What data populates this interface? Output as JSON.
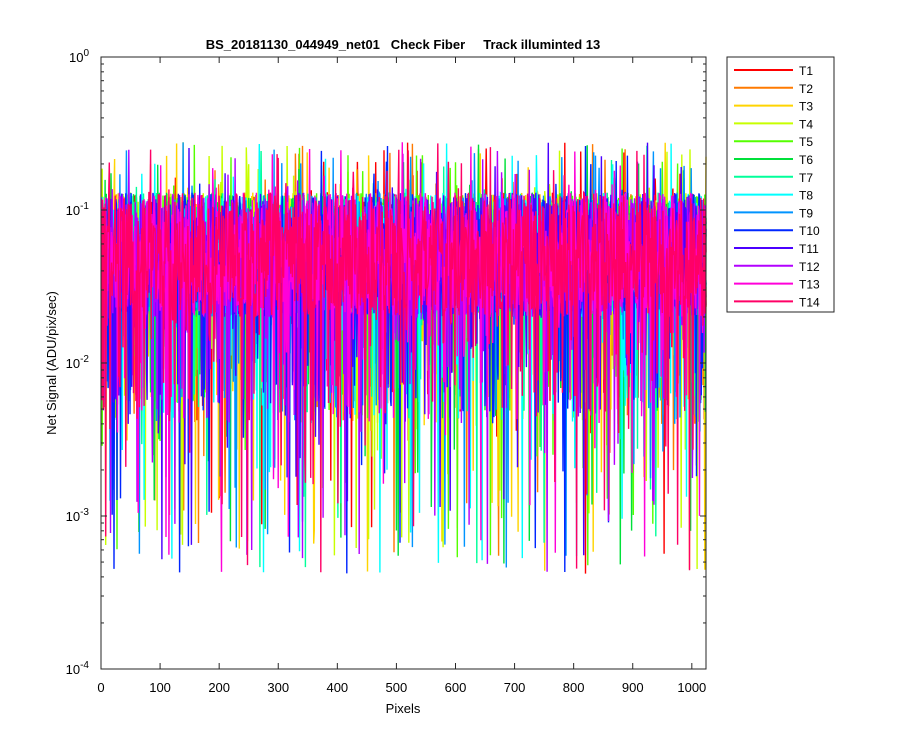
{
  "chart_data": {
    "type": "line",
    "title": "BS_20181130_044949_net01   Check Fiber     Track illuminted 13",
    "xlabel": "Pixels",
    "ylabel": "Net Signal (ADU/pix/sec)",
    "xlim": [
      0,
      1024
    ],
    "ylim": [
      0.0001,
      1
    ],
    "yscale": "log",
    "grid": false,
    "legend_position": "outside-top-right",
    "xticks": [
      0,
      100,
      200,
      300,
      400,
      500,
      600,
      700,
      800,
      900,
      1000
    ],
    "xtick_labels": [
      "0",
      "100",
      "200",
      "300",
      "400",
      "500",
      "600",
      "700",
      "800",
      "900",
      "1000"
    ],
    "yticks": [
      0.0001,
      0.001,
      0.01,
      0.1,
      1
    ],
    "ytick_labels": [
      {
        "base": "10",
        "exp": "-4"
      },
      {
        "base": "10",
        "exp": "-3"
      },
      {
        "base": "10",
        "exp": "-2"
      },
      {
        "base": "10",
        "exp": "-1"
      },
      {
        "base": "10",
        "exp": "0"
      }
    ],
    "x": {
      "start": 1,
      "end": 1024,
      "step": 1
    },
    "value_summary": {
      "typical_range": [
        0.02,
        0.13
      ],
      "max": 0.28,
      "min": 0.00042
    },
    "series": [
      {
        "name": "T1",
        "color": "#ff0000"
      },
      {
        "name": "T2",
        "color": "#ff7a00"
      },
      {
        "name": "T3",
        "color": "#ffd400"
      },
      {
        "name": "T4",
        "color": "#c8ff00"
      },
      {
        "name": "T5",
        "color": "#55ff00"
      },
      {
        "name": "T6",
        "color": "#00e03a"
      },
      {
        "name": "T7",
        "color": "#00ff9a"
      },
      {
        "name": "T8",
        "color": "#00ffff"
      },
      {
        "name": "T9",
        "color": "#0094ff"
      },
      {
        "name": "T10",
        "color": "#0026ff"
      },
      {
        "name": "T11",
        "color": "#4b00ff"
      },
      {
        "name": "T12",
        "color": "#b200ff"
      },
      {
        "name": "T13",
        "color": "#ff00d9"
      },
      {
        "name": "T14",
        "color": "#ff0066"
      }
    ]
  }
}
